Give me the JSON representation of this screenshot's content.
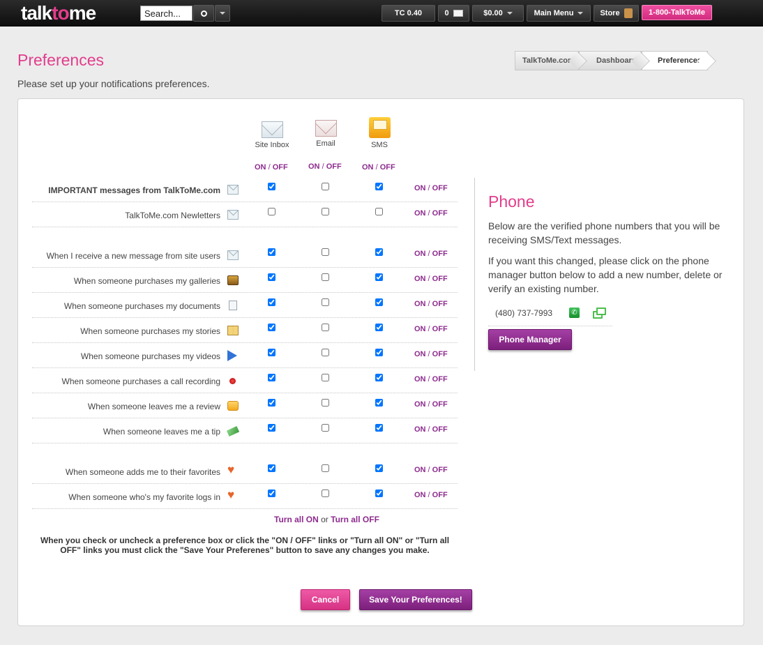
{
  "header": {
    "logo_pre": "talk",
    "logo_accent": "to",
    "logo_post": "me",
    "search_value": "Search...",
    "tc_balance": "TC 0.40",
    "message_count": "0",
    "money_balance": "$0.00",
    "main_menu_label": "Main Menu",
    "store_label": "Store",
    "phone_label": "1-800-TalkToMe"
  },
  "page": {
    "title": "Preferences",
    "subtitle": "Please set up your notifications preferences."
  },
  "breadcrumb": [
    "TalkToMe.com",
    "Dashboard",
    "Preferences"
  ],
  "columns": [
    {
      "label": "Site Inbox",
      "icon": "envelope-icon",
      "on": "ON",
      "off": "OFF"
    },
    {
      "label": "Email",
      "icon": "email-envelope-icon",
      "on": "ON",
      "off": "OFF"
    },
    {
      "label": "SMS",
      "icon": "sms-icon",
      "on": "ON",
      "off": "OFF"
    }
  ],
  "rows": [
    {
      "label": "IMPORTANT messages from TalkToMe.com",
      "icon": "envelope-icon",
      "inbox": true,
      "email": false,
      "sms": true,
      "on": "ON",
      "off": "OFF"
    },
    {
      "label": "TalkToMe.com Newletters",
      "icon": "envelope-icon",
      "inbox": false,
      "email": false,
      "sms": false,
      "on": "ON",
      "off": "OFF"
    },
    {
      "label": "When I receive a new message from site users",
      "icon": "envelope-icon",
      "inbox": true,
      "email": false,
      "sms": true,
      "on": "ON",
      "off": "OFF"
    },
    {
      "label": "When someone purchases my galleries",
      "icon": "gallery-icon",
      "inbox": true,
      "email": false,
      "sms": true,
      "on": "ON",
      "off": "OFF"
    },
    {
      "label": "When someone purchases my documents",
      "icon": "document-icon",
      "inbox": true,
      "email": false,
      "sms": true,
      "on": "ON",
      "off": "OFF"
    },
    {
      "label": "When someone purchases my stories",
      "icon": "book-icon",
      "inbox": true,
      "email": false,
      "sms": true,
      "on": "ON",
      "off": "OFF"
    },
    {
      "label": "When someone purchases my videos",
      "icon": "play-icon",
      "inbox": true,
      "email": false,
      "sms": true,
      "on": "ON",
      "off": "OFF"
    },
    {
      "label": "When someone purchases a call recording",
      "icon": "record-icon",
      "inbox": true,
      "email": false,
      "sms": true,
      "on": "ON",
      "off": "OFF"
    },
    {
      "label": "When someone leaves me a review",
      "icon": "star-icon",
      "inbox": true,
      "email": false,
      "sms": true,
      "on": "ON",
      "off": "OFF"
    },
    {
      "label": "When someone leaves me a tip",
      "icon": "money-icon",
      "inbox": true,
      "email": false,
      "sms": true,
      "on": "ON",
      "off": "OFF"
    },
    {
      "label": "When someone adds me to their favorites",
      "icon": "heart-icon",
      "inbox": true,
      "email": false,
      "sms": true,
      "on": "ON",
      "off": "OFF"
    },
    {
      "label": "When someone who's my favorite logs in",
      "icon": "heart-icon",
      "inbox": true,
      "email": false,
      "sms": true,
      "on": "ON",
      "off": "OFF"
    }
  ],
  "turn_all": {
    "on_link": "Turn all ON",
    "or": "or",
    "off_link": "Turn all OFF"
  },
  "notice": "When you check or uncheck a preference box or click the \"ON / OFF\" links or \"Turn all ON\" or \"Turn all OFF\" links you must click the \"Save Your Preferenes\" button to save any changes you make.",
  "phone": {
    "title": "Phone",
    "para1": "Below are the verified phone numbers that you will be receiving SMS/Text messages.",
    "para2": "If you want this changed, please click on the phone manager button below to add a new number, delete or verify an existing number.",
    "number": "(480) 737-7993",
    "manager_button": "Phone Manager"
  },
  "actions": {
    "cancel": "Cancel",
    "save": "Save Your Preferences!"
  },
  "colors": {
    "accent_pink": "#e23d8c",
    "accent_purple": "#8d2b8d"
  }
}
